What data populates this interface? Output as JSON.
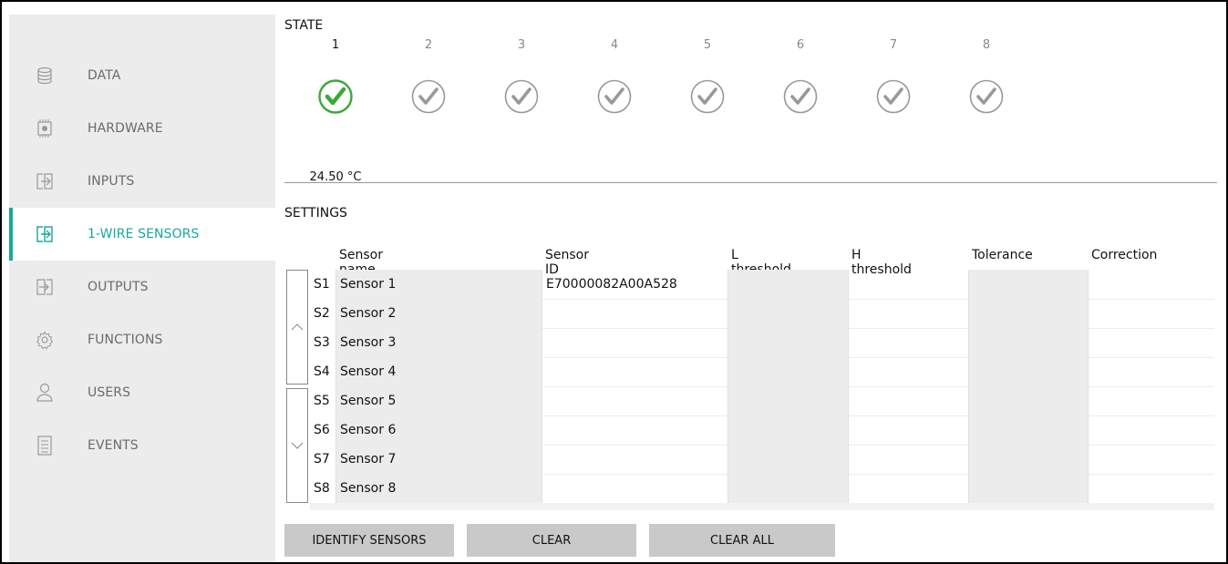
{
  "sidebar": {
    "items": [
      {
        "label": "DATA",
        "icon": "database-icon"
      },
      {
        "label": "HARDWARE",
        "icon": "chip-icon"
      },
      {
        "label": "INPUTS",
        "icon": "input-icon"
      },
      {
        "label": "1-WIRE SENSORS",
        "icon": "sensor-icon",
        "active": true
      },
      {
        "label": "OUTPUTS",
        "icon": "output-icon"
      },
      {
        "label": "FUNCTIONS",
        "icon": "gear-icon"
      },
      {
        "label": "USERS",
        "icon": "user-icon"
      },
      {
        "label": "EVENTS",
        "icon": "list-icon"
      }
    ],
    "accent_color": "#1aa6a0"
  },
  "state": {
    "title": "STATE",
    "sensors": [
      {
        "num": "1",
        "status": "active",
        "temp": "24.50 °C"
      },
      {
        "num": "2",
        "status": "inactive"
      },
      {
        "num": "3",
        "status": "inactive"
      },
      {
        "num": "4",
        "status": "inactive"
      },
      {
        "num": "5",
        "status": "inactive"
      },
      {
        "num": "6",
        "status": "inactive"
      },
      {
        "num": "7",
        "status": "inactive"
      },
      {
        "num": "8",
        "status": "inactive"
      }
    ],
    "active_color": "#3aa935"
  },
  "settings": {
    "title": "SETTINGS",
    "columns": [
      "Sensor name",
      "Sensor ID",
      "L threshold",
      "H threshold",
      "Tolerance",
      "Correction"
    ],
    "rows": [
      {
        "idx": "S1",
        "name": "Sensor 1",
        "id": "E70000082A00A528"
      },
      {
        "idx": "S2",
        "name": "Sensor 2",
        "id": ""
      },
      {
        "idx": "S3",
        "name": "Sensor 3",
        "id": ""
      },
      {
        "idx": "S4",
        "name": "Sensor 4",
        "id": ""
      },
      {
        "idx": "S5",
        "name": "Sensor 5",
        "id": ""
      },
      {
        "idx": "S6",
        "name": "Sensor 6",
        "id": ""
      },
      {
        "idx": "S7",
        "name": "Sensor 7",
        "id": ""
      },
      {
        "idx": "S8",
        "name": "Sensor 8",
        "id": ""
      }
    ]
  },
  "buttons": {
    "identify": "IDENTIFY SENSORS",
    "clear": "CLEAR",
    "clear_all": "CLEAR ALL"
  }
}
